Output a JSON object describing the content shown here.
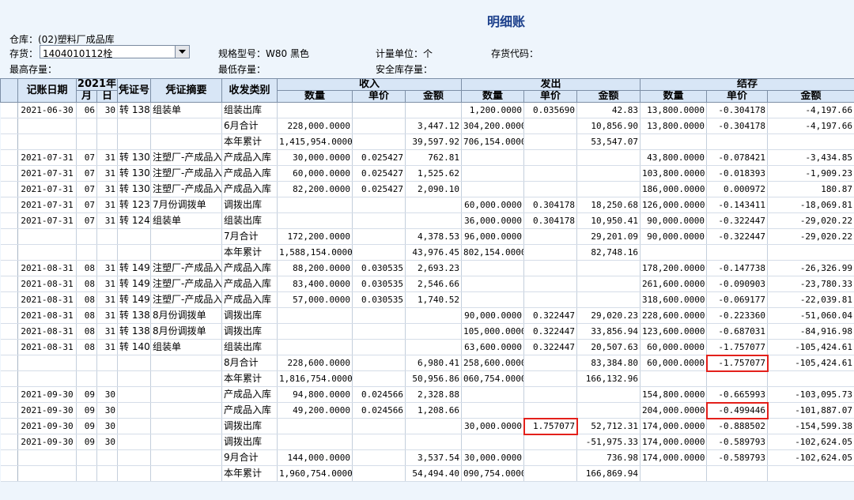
{
  "window_title": "明细账",
  "header": {
    "warehouse": "仓库：(02)塑料厂成品库",
    "inventory_label": "存货：",
    "inventory_value": "1404010112栓",
    "spec": "规格型号：W80 黑色",
    "unit": "计量单位：个",
    "code": "存货代码：",
    "max_stock": "最高存量：",
    "min_stock": "最低存量：",
    "safety_stock": "安全库存量："
  },
  "columns": {
    "date": "记账日期",
    "year": "2021年",
    "month": "月",
    "day": "日",
    "voucher": "凭证号",
    "summary": "凭证摘要",
    "category": "收发类别",
    "income": "收入",
    "outgo": "发出",
    "balance": "结存",
    "qty": "数量",
    "price": "单价",
    "amount": "金额"
  },
  "rows": [
    [
      "2021-06-30",
      "06",
      "30",
      "转 138",
      "组装单",
      "组装出库",
      "",
      "",
      "",
      "1,200.0000",
      "0.035690",
      "42.83",
      "13,800.0000",
      "-0.304178",
      "-4,197.66"
    ],
    [
      "",
      "",
      "",
      "",
      "",
      "6月合计",
      "228,000.0000",
      "",
      "3,447.12",
      "304,200.0000",
      "",
      "10,856.90",
      "13,800.0000",
      "-0.304178",
      "-4,197.66"
    ],
    [
      "",
      "",
      "",
      "",
      "",
      "本年累计",
      "1,415,954.0000",
      "",
      "39,597.92",
      "706,154.0000",
      "",
      "53,547.07",
      "",
      "",
      ""
    ],
    [
      "2021-07-31",
      "07",
      "31",
      "转 130",
      "注塑厂-产成品入",
      "产成品入库",
      "30,000.0000",
      "0.025427",
      "762.81",
      "",
      "",
      "",
      "43,800.0000",
      "-0.078421",
      "-3,434.85"
    ],
    [
      "2021-07-31",
      "07",
      "31",
      "转 130",
      "注塑厂-产成品入",
      "产成品入库",
      "60,000.0000",
      "0.025427",
      "1,525.62",
      "",
      "",
      "",
      "103,800.0000",
      "-0.018393",
      "-1,909.23"
    ],
    [
      "2021-07-31",
      "07",
      "31",
      "转 130",
      "注塑厂-产成品入",
      "产成品入库",
      "82,200.0000",
      "0.025427",
      "2,090.10",
      "",
      "",
      "",
      "186,000.0000",
      "0.000972",
      "180.87"
    ],
    [
      "2021-07-31",
      "07",
      "31",
      "转 123",
      "7月份调拨单",
      "调拨出库",
      "",
      "",
      "",
      "60,000.0000",
      "0.304178",
      "18,250.68",
      "126,000.0000",
      "-0.143411",
      "-18,069.81"
    ],
    [
      "2021-07-31",
      "07",
      "31",
      "转 124",
      "组装单",
      "组装出库",
      "",
      "",
      "",
      "36,000.0000",
      "0.304178",
      "10,950.41",
      "90,000.0000",
      "-0.322447",
      "-29,020.22"
    ],
    [
      "",
      "",
      "",
      "",
      "",
      "7月合计",
      "172,200.0000",
      "",
      "4,378.53",
      "96,000.0000",
      "",
      "29,201.09",
      "90,000.0000",
      "-0.322447",
      "-29,020.22"
    ],
    [
      "",
      "",
      "",
      "",
      "",
      "本年累计",
      "1,588,154.0000",
      "",
      "43,976.45",
      "802,154.0000",
      "",
      "82,748.16",
      "",
      "",
      ""
    ],
    [
      "2021-08-31",
      "08",
      "31",
      "转 149",
      "注塑厂-产成品入",
      "产成品入库",
      "88,200.0000",
      "0.030535",
      "2,693.23",
      "",
      "",
      "",
      "178,200.0000",
      "-0.147738",
      "-26,326.99"
    ],
    [
      "2021-08-31",
      "08",
      "31",
      "转 149",
      "注塑厂-产成品入",
      "产成品入库",
      "83,400.0000",
      "0.030535",
      "2,546.66",
      "",
      "",
      "",
      "261,600.0000",
      "-0.090903",
      "-23,780.33"
    ],
    [
      "2021-08-31",
      "08",
      "31",
      "转 149",
      "注塑厂-产成品入",
      "产成品入库",
      "57,000.0000",
      "0.030535",
      "1,740.52",
      "",
      "",
      "",
      "318,600.0000",
      "-0.069177",
      "-22,039.81"
    ],
    [
      "2021-08-31",
      "08",
      "31",
      "转 138",
      "8月份调拨单",
      "调拨出库",
      "",
      "",
      "",
      "90,000.0000",
      "0.322447",
      "29,020.23",
      "228,600.0000",
      "-0.223360",
      "-51,060.04"
    ],
    [
      "2021-08-31",
      "08",
      "31",
      "转 138",
      "8月份调拨单",
      "调拨出库",
      "",
      "",
      "",
      "105,000.0000",
      "0.322447",
      "33,856.94",
      "123,600.0000",
      "-0.687031",
      "-84,916.98"
    ],
    [
      "2021-08-31",
      "08",
      "31",
      "转 140",
      "组装单",
      "组装出库",
      "",
      "",
      "",
      "63,600.0000",
      "0.322447",
      "20,507.63",
      "60,000.0000",
      "-1.757077",
      "-105,424.61"
    ],
    [
      "",
      "",
      "",
      "",
      "",
      "8月合计",
      "228,600.0000",
      "",
      "6,980.41",
      "258,600.0000",
      "",
      "83,384.80",
      "60,000.0000",
      "-1.757077",
      "-105,424.61"
    ],
    [
      "",
      "",
      "",
      "",
      "",
      "本年累计",
      "1,816,754.0000",
      "",
      "50,956.86",
      "060,754.0000",
      "",
      "166,132.96",
      "",
      "",
      ""
    ],
    [
      "2021-09-30",
      "09",
      "30",
      "",
      "",
      "产成品入库",
      "94,800.0000",
      "0.024566",
      "2,328.88",
      "",
      "",
      "",
      "154,800.0000",
      "-0.665993",
      "-103,095.73"
    ],
    [
      "2021-09-30",
      "09",
      "30",
      "",
      "",
      "产成品入库",
      "49,200.0000",
      "0.024566",
      "1,208.66",
      "",
      "",
      "",
      "204,000.0000",
      "-0.499446",
      "-101,887.07"
    ],
    [
      "2021-09-30",
      "09",
      "30",
      "",
      "",
      "调拨出库",
      "",
      "",
      "",
      "30,000.0000",
      "1.757077",
      "52,712.31",
      "174,000.0000",
      "-0.888502",
      "-154,599.38"
    ],
    [
      "2021-09-30",
      "09",
      "30",
      "",
      "",
      "调拨出库",
      "",
      "",
      "",
      "",
      "",
      "-51,975.33",
      "174,000.0000",
      "-0.589793",
      "-102,624.05"
    ],
    [
      "",
      "",
      "",
      "",
      "",
      "9月合计",
      "144,000.0000",
      "",
      "3,537.54",
      "30,000.0000",
      "",
      "736.98",
      "174,000.0000",
      "-0.589793",
      "-102,624.05"
    ],
    [
      "",
      "",
      "",
      "",
      "",
      "本年累计",
      "1,960,754.0000",
      "",
      "54,494.40",
      "090,754.0000",
      "",
      "166,869.94",
      "",
      "",
      ""
    ]
  ],
  "highlights": [
    [
      16,
      13
    ],
    [
      19,
      13
    ],
    [
      20,
      10
    ]
  ],
  "highlight_color": "#e3201b"
}
